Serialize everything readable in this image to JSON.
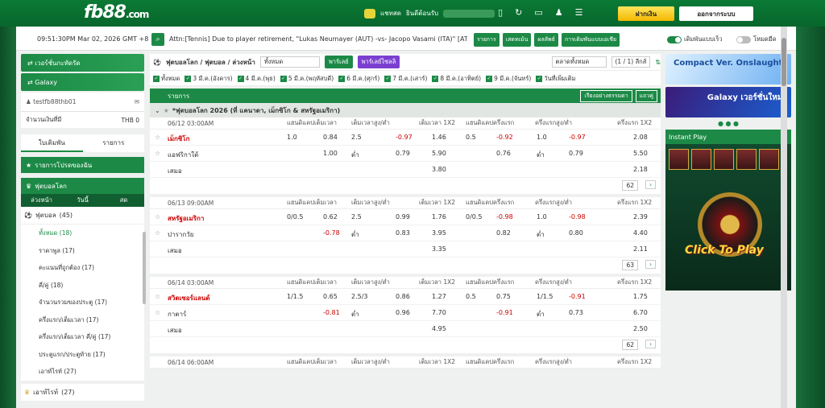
{
  "header": {
    "logo": "fb88",
    "logo_tld": ".com",
    "chat_label": "แชทสด",
    "welcome_label": "ยินดีต้อนรับ",
    "deposit_label": "ฝากเงิน",
    "logout_label": "ออกจากระบบ"
  },
  "infobar": {
    "clock": "09:51:30PM Mar 02, 2026 GMT +8",
    "marquee": "Attn:[Tennis] Due to player retirement, \"Lukas Neumayer (AUT) -vs- Jacopo Vasami (ITA)\" [ATP",
    "buttons": [
      "รายการ",
      "เสดทเม้น",
      "ผลลัพธ์",
      "การเดิมพันแบบเอเชีย"
    ],
    "fast_bet_label": "เดิมพันแบบเร็ว",
    "night_mode_label": "โหมดมืด"
  },
  "sidebar": {
    "banner1": "เวอร์ชั่นกะทัดรัด",
    "banner2": "Galaxy",
    "username": "testfb88thb01",
    "balance_label": "จำนวนเงินที่มี",
    "balance_value": "THB 0",
    "tab_betslip": "ใบเดิมพัน",
    "tab_list": "รายการ",
    "favorites_label": "รายการโปรดของฉัน",
    "football_section": "ฟุตบอลโลก",
    "sub_tabs": [
      "ล่วงหน้า",
      "วันนี้",
      "สด"
    ],
    "sport": "ฟุตบอล",
    "sport_count": "(45)",
    "leagues": [
      {
        "label": "ทั้งหมด",
        "count": "(18)"
      },
      {
        "label": "ราคาพูล",
        "count": "(17)"
      },
      {
        "label": "คะแนนที่ถูกต้อง",
        "count": "(17)"
      },
      {
        "label": "คี่/คู่",
        "count": "(18)"
      },
      {
        "label": "จำนวนรวมของประตู",
        "count": "(17)"
      },
      {
        "label": "ครึ่งแรก/เต็มเวลา",
        "count": "(17)"
      },
      {
        "label": "ครึ่งแรก/เต็มเวลา คี่/คู่",
        "count": "(17)"
      },
      {
        "label": "ประตูแรก/ประตูท้าย",
        "count": "(17)"
      },
      {
        "label": "เอาท์ไรท์",
        "count": "(27)"
      }
    ],
    "outright_label": "เอาท์ไรท์",
    "outright_count": "(27)"
  },
  "content": {
    "breadcrumb": "ฟุตบอลโลก / ฟุตบอล / ล่วงหน้า",
    "filter": "ทั้งหมด",
    "parlay": "พาร์เลย์",
    "parlay2": "พาร์เลย์ไซลลิ",
    "market_select": "ตลาดทั้งหมด",
    "league_count": "(1 / 1) ลีกส์",
    "dates": [
      "ทั้งหมด",
      "3 มี.ค.(อังคาร)",
      "4 มี.ค.(พุธ)",
      "5 มี.ค.(พฤหัสบดี)",
      "6 มี.ค.(ศุกร์)",
      "7 มี.ค.(เสาร์)",
      "8 มี.ค.(อาทิตย์)",
      "9 มี.ค.(จันทร์)",
      "วันที่เพิ่มเติม"
    ],
    "list_head": "รายการ",
    "sort_label": "เรียงอย่างธรรมดา",
    "expand_label": "แถวคู่",
    "league_title": "*ฟุตบอลโลก 2026 (ที่ แคนาดา, เม็กซิโก & สหรัฐอเมริกา)",
    "col_heads": [
      "แฮนดิแคปเต็มเวลา",
      "เต็มเวลาสูง/ต่ำ",
      "เต็มเวลา 1X2",
      "แฮนดิแคปครึ่งแรก",
      "ครึ่งแรกสูง/ต่ำ",
      "ครึ่งแรก 1X2"
    ],
    "matches": [
      {
        "time": "06/12 03:00AM",
        "home": "เม็กซิโก",
        "away": "แอฟริกาใต้",
        "draw": "เสมอ",
        "r1": [
          "1.0",
          "0.84",
          "2.5",
          "-0.97",
          "1.46",
          "0.5",
          "-0.92",
          "1.0",
          "-0.97",
          "2.08"
        ],
        "r2": [
          "",
          "1.00",
          "ต่ำ",
          "0.79",
          "5.90",
          "",
          "0.76",
          "ต่ำ",
          "0.79",
          "5.50"
        ],
        "r3": [
          "3.80",
          "2.18"
        ],
        "more": "62"
      },
      {
        "time": "06/13 09:00AM",
        "home": "สหรัฐอเมริกา",
        "away": "ปารากวัย",
        "draw": "เสมอ",
        "r1": [
          "0/0.5",
          "0.62",
          "2.5",
          "0.99",
          "1.76",
          "0/0.5",
          "-0.98",
          "1.0",
          "-0.98",
          "2.39"
        ],
        "r2": [
          "",
          "-0.78",
          "ต่ำ",
          "0.83",
          "3.95",
          "",
          "0.82",
          "ต่ำ",
          "0.80",
          "4.40"
        ],
        "r3": [
          "3.35",
          "2.11"
        ],
        "more": "63"
      },
      {
        "time": "06/14 03:00AM",
        "home": "สวิตเซอร์แลนด์",
        "away": "กาตาร์",
        "draw": "เสมอ",
        "r1": [
          "1/1.5",
          "0.65",
          "2.5/3",
          "0.86",
          "1.27",
          "0.5",
          "0.75",
          "1/1.5",
          "-0.91",
          "1.75"
        ],
        "r2": [
          "",
          "-0.81",
          "ต่ำ",
          "0.96",
          "7.70",
          "",
          "-0.91",
          "ต่ำ",
          "0.73",
          "6.70"
        ],
        "r3": [
          "4.95",
          "2.50"
        ],
        "more": "62"
      }
    ],
    "next_time": "06/14 06:00AM"
  },
  "right": {
    "promo1": "Compact Ver. Onslaught!",
    "promo2": "Galaxy เวอร์ชั่นใหม่!",
    "instant_play": "Instant Play",
    "click_to_play": "Click To Play"
  }
}
